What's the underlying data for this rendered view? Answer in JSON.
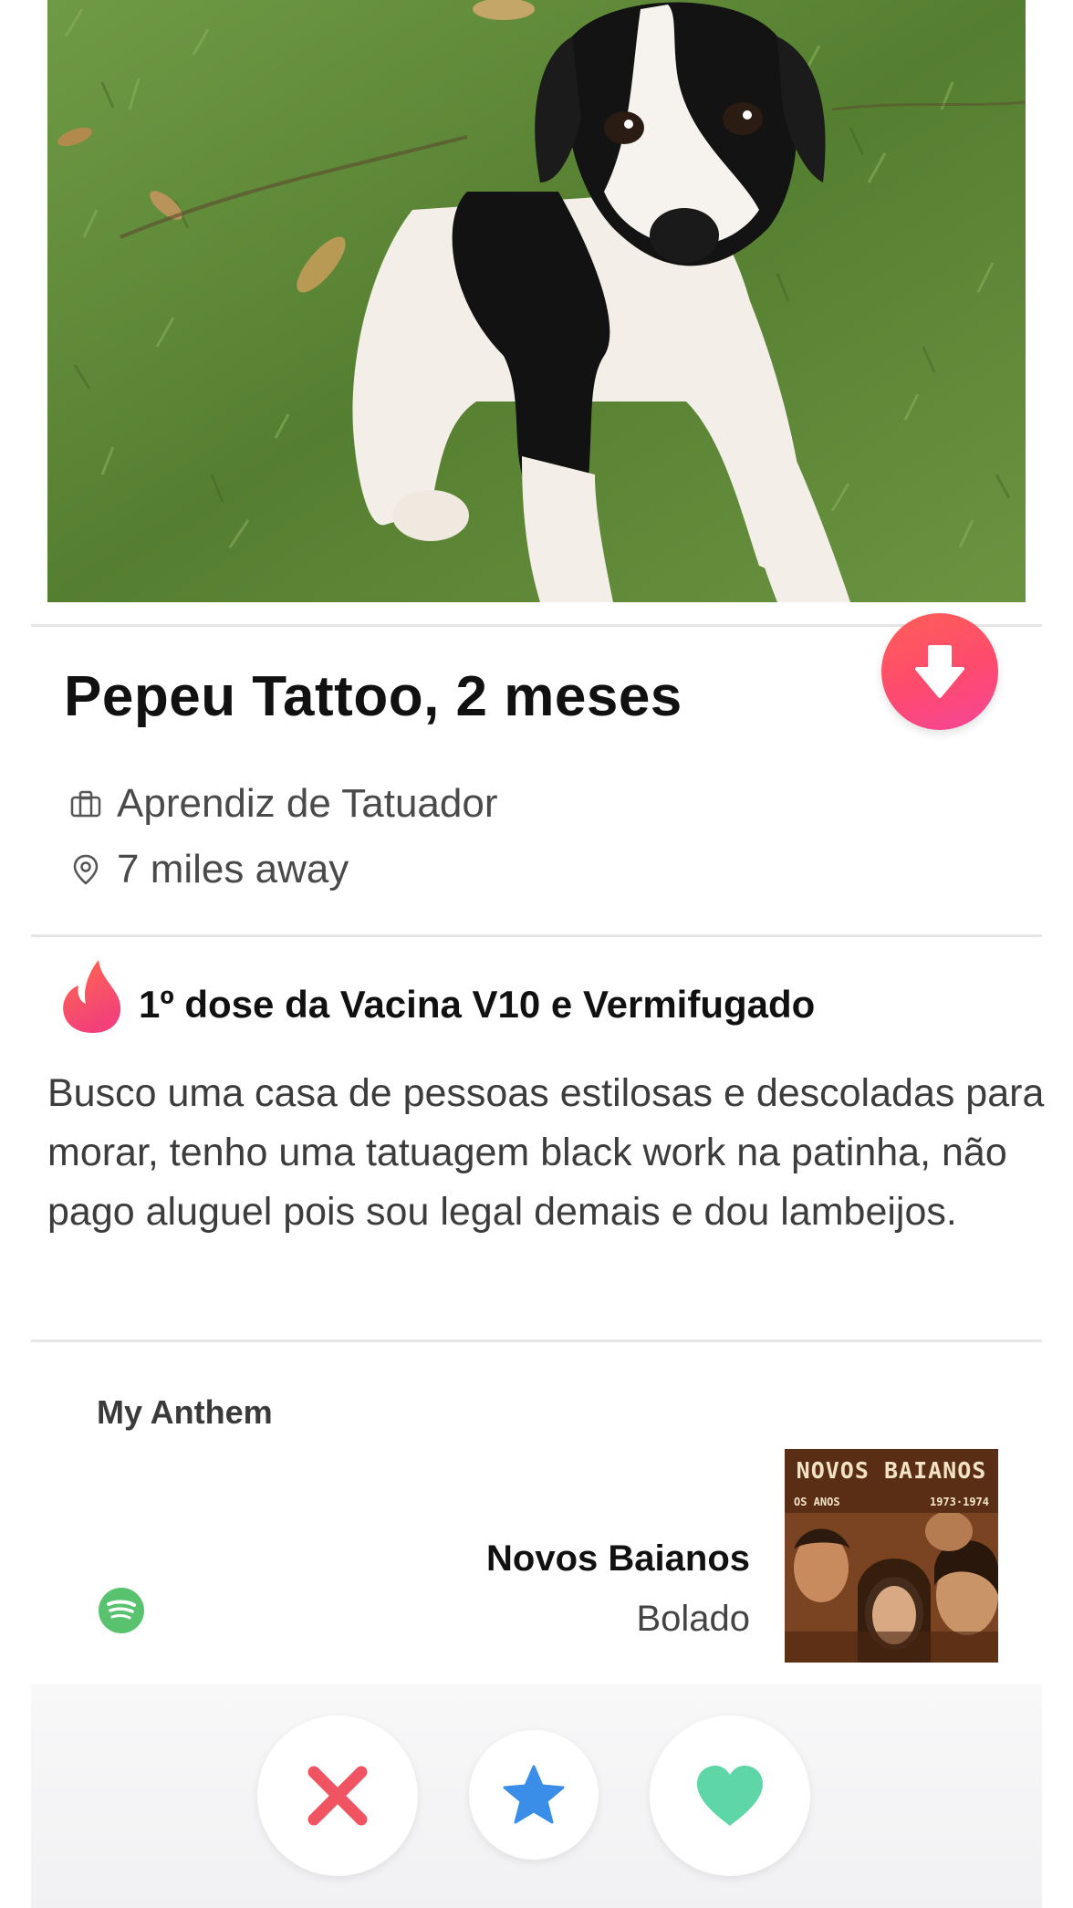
{
  "profile": {
    "name_age": "Pepeu Tattoo, 2 meses",
    "job": "Aprendiz de Tatuador",
    "distance": "7 miles away"
  },
  "bio": {
    "headline": "1º dose da Vacina V10 e Vermifugado",
    "text": "Busco uma casa de pessoas estilosas e descoladas para morar, tenho uma tatuagem black work na patinha, não pago aluguel pois sou legal demais e dou lambeijos."
  },
  "anthem": {
    "section_title": "My Anthem",
    "song": "Novos Baianos",
    "artist": "Bolado",
    "album_cover": {
      "title": "NOVOS BAIANOS",
      "subtitle_left": "OS ANOS",
      "subtitle_right": "1973·1974"
    }
  },
  "actions": {
    "nope_icon": "x-icon",
    "super_like_icon": "star-icon",
    "like_icon": "heart-icon"
  },
  "colors": {
    "brand_gradient_start": "#ff5f57",
    "brand_gradient_end": "#f54599",
    "nope": "#f05462",
    "super_like": "#3a8ee8",
    "like": "#5fd6a8",
    "spotify": "#58c26f"
  }
}
